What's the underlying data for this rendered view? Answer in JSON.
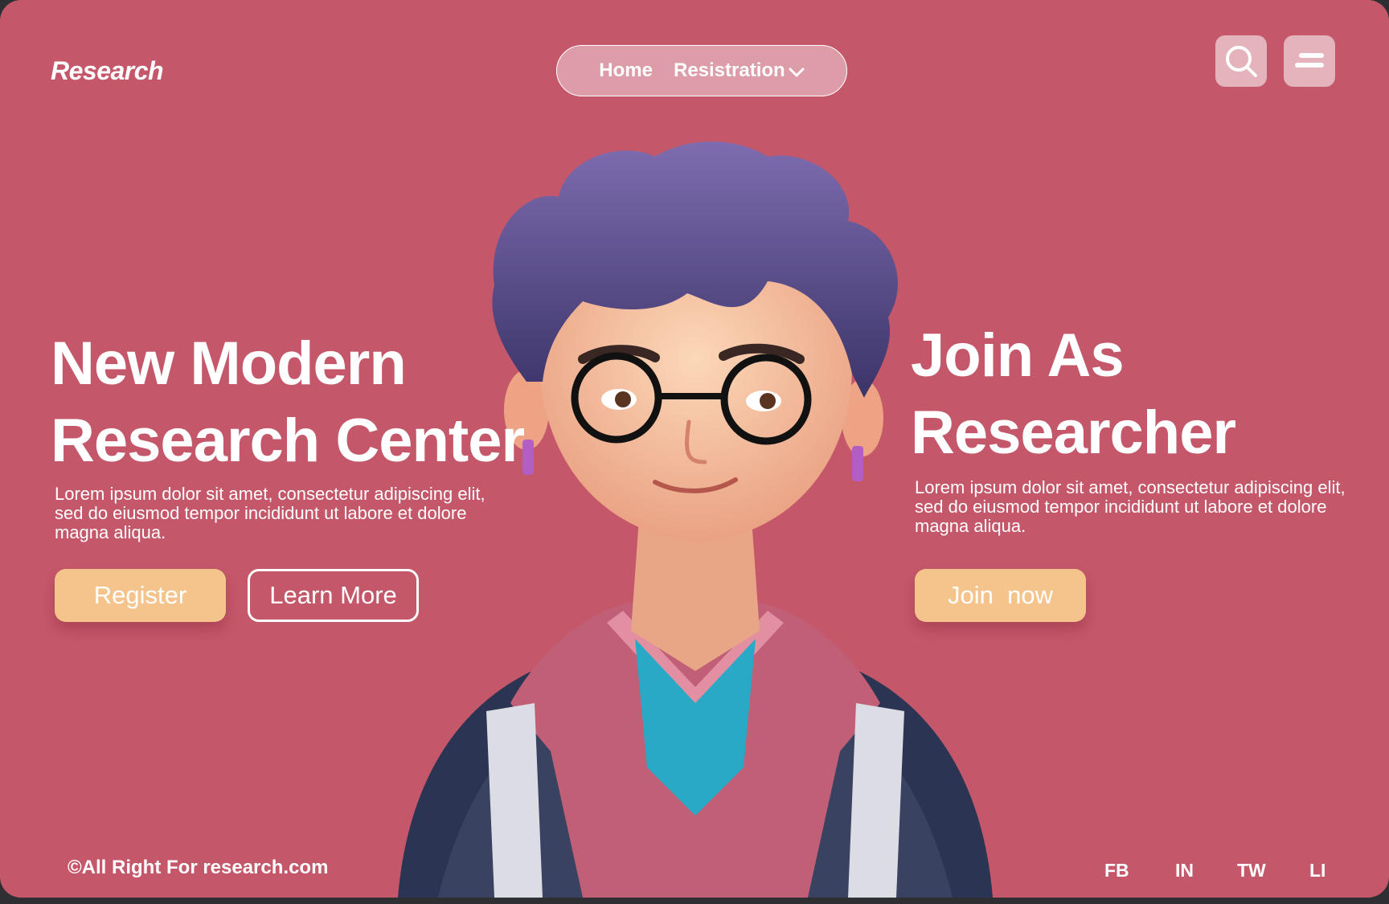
{
  "brand": "Research",
  "nav": {
    "home": "Home",
    "registration": "Resistration"
  },
  "icons": {
    "search": "search-icon",
    "menu": "menu-icon",
    "dropdown": "chevron-down-icon"
  },
  "hero": {
    "title_line1": "New Modern",
    "title_line2": "Research Center",
    "text": "Lorem ipsum dolor sit amet, consectetur adipiscing elit, sed do eiusmod tempor incididunt ut labore et dolore magna aliqua.",
    "register_label": "Register",
    "learn_label": "Learn More"
  },
  "join": {
    "title_line1": "Join As",
    "title_line2": "Researcher",
    "text": "Lorem ipsum dolor sit amet, consectetur adipiscing elit, sed do eiusmod tempor incididunt ut labore et dolore magna aliqua.",
    "button_label": "Join  now"
  },
  "footer": {
    "copyright": "©All Right For research.com",
    "socials": [
      "FB",
      "IN",
      "TW",
      "LI"
    ]
  },
  "colors": {
    "background": "#c45769",
    "button": "#f5c48c",
    "text": "#ffffff"
  }
}
